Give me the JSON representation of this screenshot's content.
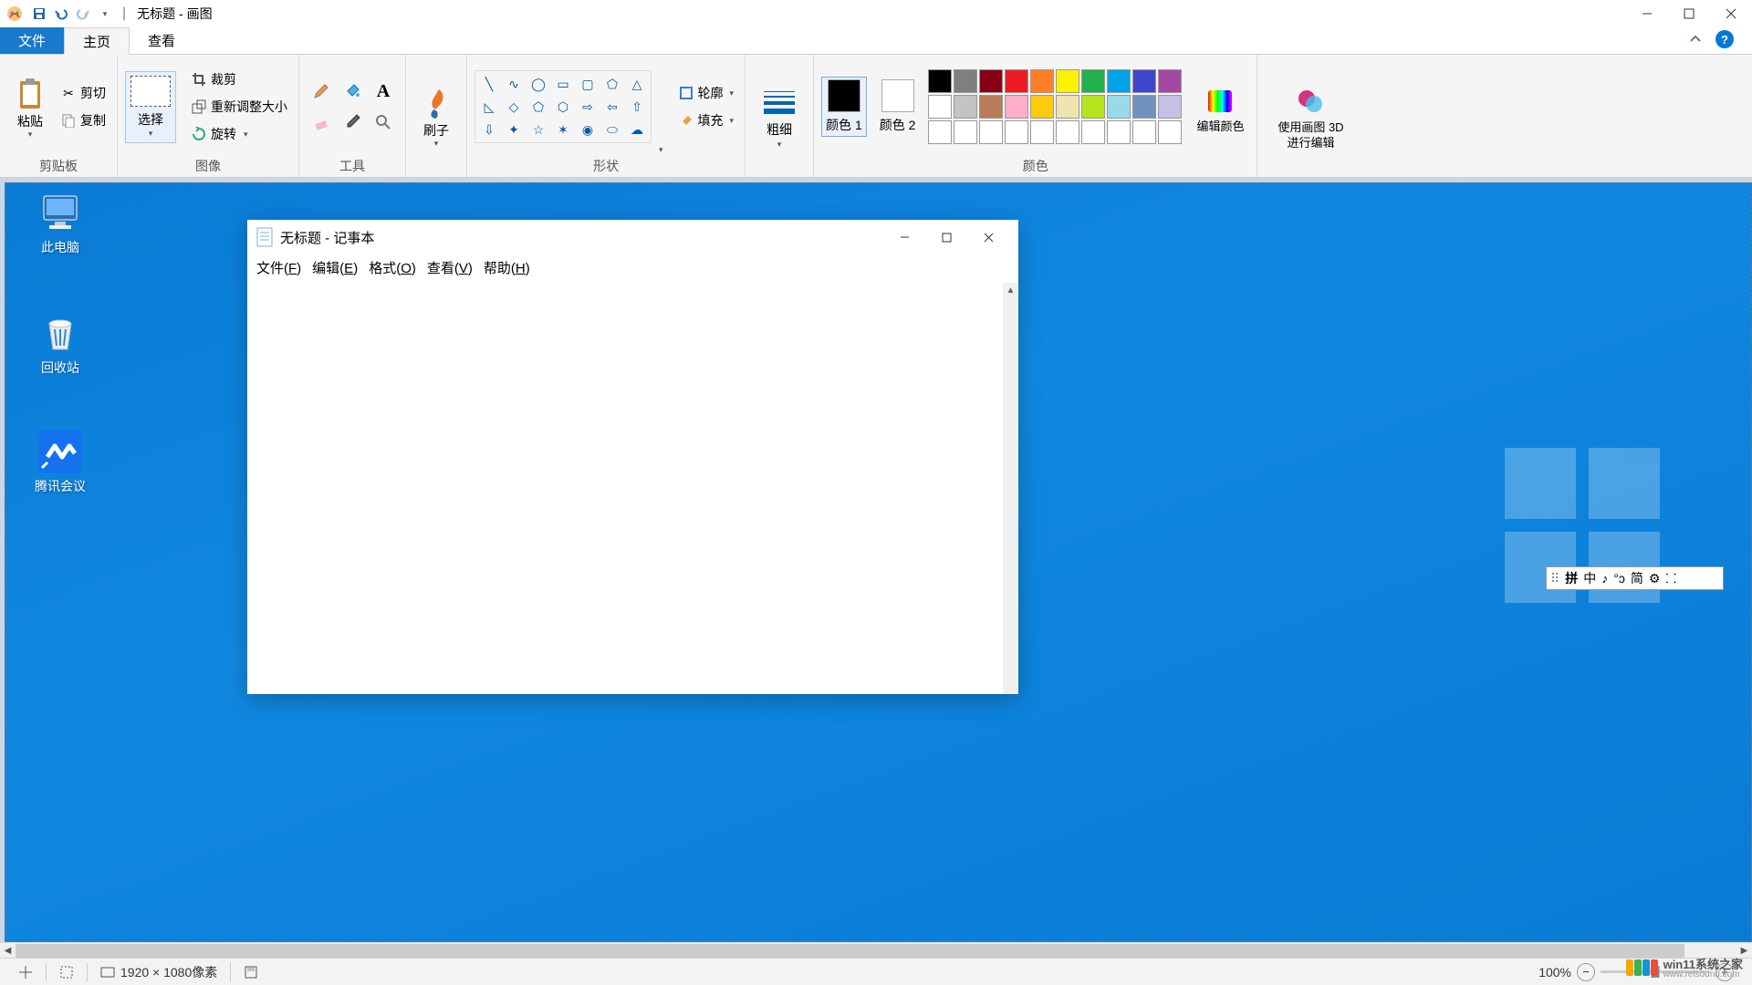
{
  "titlebar": {
    "title": "无标题 - 画图",
    "qat_separator": "|"
  },
  "tabs": {
    "file": "文件",
    "home": "主页",
    "view": "查看"
  },
  "ribbon": {
    "clipboard": {
      "paste": "粘贴",
      "cut": "剪切",
      "copy": "复制",
      "label": "剪贴板"
    },
    "image": {
      "select": "选择",
      "crop": "裁剪",
      "resize": "重新调整大小",
      "rotate": "旋转",
      "label": "图像"
    },
    "tools": {
      "label": "工具"
    },
    "brush": {
      "label": "刷子"
    },
    "shapes": {
      "outline": "轮廓",
      "fill": "填充",
      "label": "形状"
    },
    "size": {
      "label": "粗细"
    },
    "colors": {
      "color1": "颜色 1",
      "color2": "颜色 2",
      "edit": "编辑颜色",
      "label": "颜色",
      "color1_value": "#000000",
      "color2_value": "#ffffff",
      "palette_row1": [
        "#000000",
        "#7f7f7f",
        "#880015",
        "#ed1c24",
        "#ff7f27",
        "#fff200",
        "#22b14c",
        "#00a2e8",
        "#3f48cc",
        "#a349a4"
      ],
      "palette_row2": [
        "#ffffff",
        "#c3c3c3",
        "#b97a57",
        "#ffaec9",
        "#ffc90e",
        "#efe4b0",
        "#b5e61d",
        "#99d9ea",
        "#7092be",
        "#c8bfe7"
      ],
      "palette_row3": [
        "#ffffff",
        "#ffffff",
        "#ffffff",
        "#ffffff",
        "#ffffff",
        "#ffffff",
        "#ffffff",
        "#ffffff",
        "#ffffff",
        "#ffffff"
      ]
    },
    "paint3d": {
      "label": "使用画图 3D 进行编辑"
    }
  },
  "desktop_icons": {
    "pc": "此电脑",
    "bin": "回收站",
    "tencent": "腾讯会议"
  },
  "notepad": {
    "title": "无标题 - 记事本",
    "menu": {
      "file": "文件(F)",
      "edit": "编辑(E)",
      "format": "格式(O)",
      "view": "查看(V)",
      "help": "帮助(H)"
    }
  },
  "ime": {
    "items": [
      "拼",
      "中",
      "♪",
      "°ɔ",
      "简",
      "⚙",
      "⸬"
    ]
  },
  "statusbar": {
    "dimensions": "1920 × 1080像素",
    "zoom": "100%"
  },
  "watermark": {
    "text": "win11系统之家",
    "sub": "www.relsound.com"
  }
}
